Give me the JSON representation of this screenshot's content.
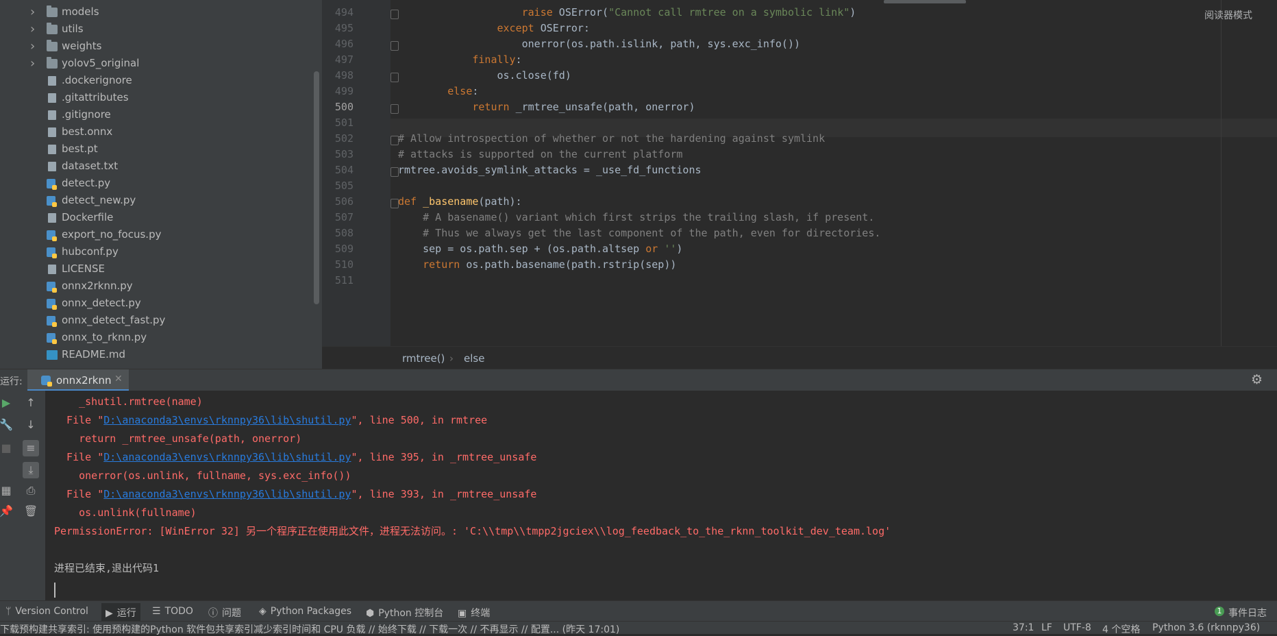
{
  "project_tree": {
    "items": [
      {
        "label": "models",
        "type": "folder",
        "expandable": true
      },
      {
        "label": "utils",
        "type": "folder",
        "expandable": true
      },
      {
        "label": "weights",
        "type": "folder",
        "expandable": true
      },
      {
        "label": "yolov5_original",
        "type": "folder",
        "expandable": true
      },
      {
        "label": ".dockerignore",
        "type": "file"
      },
      {
        "label": ".gitattributes",
        "type": "file"
      },
      {
        "label": ".gitignore",
        "type": "file"
      },
      {
        "label": "best.onnx",
        "type": "file"
      },
      {
        "label": "best.pt",
        "type": "file"
      },
      {
        "label": "dataset.txt",
        "type": "file"
      },
      {
        "label": "detect.py",
        "type": "python"
      },
      {
        "label": "detect_new.py",
        "type": "python"
      },
      {
        "label": "Dockerfile",
        "type": "file"
      },
      {
        "label": "export_no_focus.py",
        "type": "python"
      },
      {
        "label": "hubconf.py",
        "type": "python"
      },
      {
        "label": "LICENSE",
        "type": "file"
      },
      {
        "label": "onnx2rknn.py",
        "type": "python"
      },
      {
        "label": "onnx_detect.py",
        "type": "python"
      },
      {
        "label": "onnx_detect_fast.py",
        "type": "python"
      },
      {
        "label": "onnx_to_rknn.py",
        "type": "python"
      },
      {
        "label": "README.md",
        "type": "markdown"
      }
    ]
  },
  "editor": {
    "reader_mode": "阅读器模式",
    "current_line": "500",
    "line_numbers": [
      "494",
      "495",
      "496",
      "497",
      "498",
      "499",
      "500",
      "501",
      "502",
      "503",
      "504",
      "505",
      "506",
      "507",
      "508",
      "509",
      "510",
      "511"
    ],
    "breadcrumbs": [
      "rmtree()",
      "else"
    ]
  },
  "run_panel": {
    "label": "运行:",
    "tab_label": "onnx2rknn",
    "console": {
      "l1": "    _shutil.rmtree(name)",
      "file_prefix": "  File \"",
      "path": "D:\\anaconda3\\envs\\rknnpy36\\lib\\shutil.py",
      "l2_suffix": "\", line 500, in rmtree",
      "l3": "    return _rmtree_unsafe(path, onerror)",
      "l4_suffix": "\", line 395, in _rmtree_unsafe",
      "l5": "    onerror(os.unlink, fullname, sys.exc_info())",
      "l6_suffix": "\", line 393, in _rmtree_unsafe",
      "l7": "    os.unlink(fullname)",
      "error": "PermissionError: [WinError 32] 另一个程序正在使用此文件，进程无法访问。: 'C:\\\\tmp\\\\tmpp2jgciex\\\\log_feedback_to_the_rknn_toolkit_dev_team.log'",
      "exit": "进程已结束,退出代码1"
    }
  },
  "tool_windows": {
    "version_control": "Version Control",
    "run": "运行",
    "todo": "TODO",
    "problems": "问题",
    "python_packages": "Python Packages",
    "python_console": "Python 控制台",
    "terminal": "终端",
    "event_log": "事件日志",
    "event_count": "1"
  },
  "status_bar": {
    "message": "下载预构建共享索引: 使用预构建的Python 软件包共享索引减少索引时间和 CPU 负载 // 始终下载 // 下载一次 // 不再显示 // 配置... (昨天 17:01)",
    "position": "37:1",
    "line_ending": "LF",
    "encoding": "UTF-8",
    "indent": "4 个空格",
    "interpreter": "Python 3.6 (rknnpy36)"
  }
}
